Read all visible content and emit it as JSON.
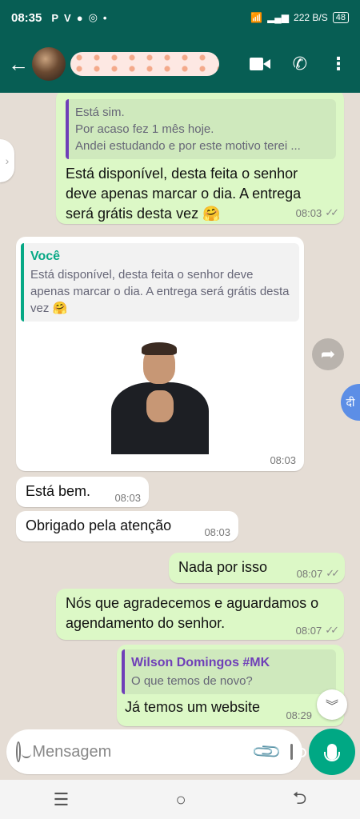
{
  "status_bar": {
    "time": "08:35",
    "icons": [
      "P",
      "V",
      "●",
      "◎",
      "•"
    ],
    "network_speed": "222 B/S",
    "battery": "48"
  },
  "header": {
    "contact_name": "",
    "back_icon": "arrow-left",
    "actions": [
      "video-call-icon",
      "phone-icon",
      "more-vert-icon"
    ]
  },
  "messages": [
    {
      "direction": "out",
      "quote": {
        "lines": [
          "Está sim.",
          "Por acaso fez 1 mês hoje.",
          "Andei estudando e por este motivo terei ..."
        ]
      },
      "text": "Está disponível, desta feita o senhor deve apenas marcar o dia. A entrega será grátis desta vez 🤗",
      "time": "08:03",
      "ticks": "✓✓"
    },
    {
      "direction": "in",
      "quote": {
        "author": "Você",
        "text": "Está disponível, desta feita o senhor deve apenas marcar o dia. A entrega será grátis desta vez 🤗"
      },
      "sticker": "clapping-man",
      "time": "08:03"
    },
    {
      "direction": "in",
      "text": "Está bem.",
      "time": "08:03"
    },
    {
      "direction": "in",
      "text": "Obrigado pela atenção",
      "time": "08:03"
    },
    {
      "direction": "out",
      "text": "Nada por isso",
      "time": "08:07",
      "ticks": "✓✓"
    },
    {
      "direction": "out",
      "text": "Nós que agradecemos e aguardamos o agendamento do senhor.",
      "time": "08:07",
      "ticks": "✓✓"
    },
    {
      "direction": "out",
      "quote": {
        "author": "Wilson Domingos #MK",
        "text": "O que temos de novo?"
      },
      "text": "Já temos um website",
      "time": "08:29"
    }
  ],
  "input": {
    "placeholder": "Mensagem"
  },
  "side": {
    "translate_label": "दी"
  },
  "nav_bar": {
    "recents": "☰",
    "home": "○",
    "back": "⮌"
  },
  "colors": {
    "header": "#075e54",
    "outgoing_bubble": "#dcf8c6",
    "incoming_bubble": "#ffffff",
    "chat_bg": "#e5ddd5",
    "mic_button": "#00a884"
  }
}
